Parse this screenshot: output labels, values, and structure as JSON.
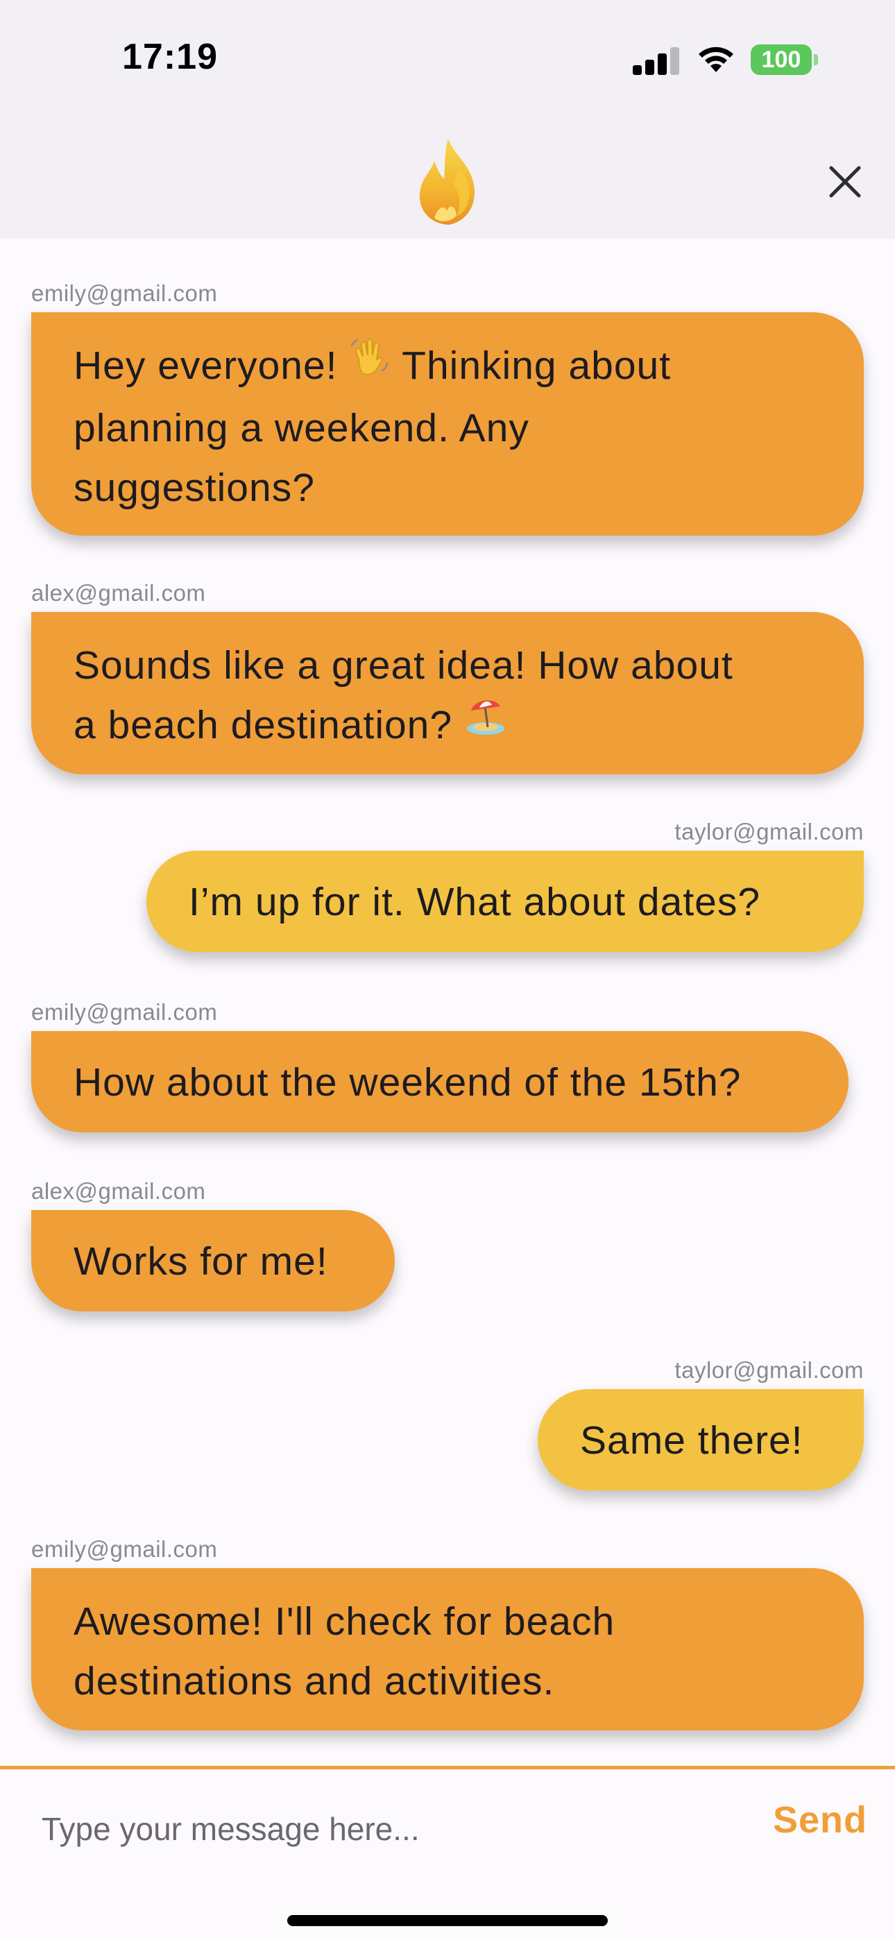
{
  "status_bar": {
    "time": "17:19",
    "battery_level": "100",
    "icons": [
      "cellular-signal-icon",
      "wifi-icon",
      "battery-icon"
    ]
  },
  "header": {
    "logo_icon": "flame-logo-icon",
    "close_icon": "close-icon"
  },
  "messages": [
    {
      "sender": "emily@gmail.com",
      "side": "left",
      "lines": [
        "Hey everyone! ",
        " Thinking about",
        "planning a weekend. Any",
        "suggestions?"
      ],
      "emoji": "waving-hand-emoji"
    },
    {
      "sender": "alex@gmail.com",
      "side": "left",
      "lines": [
        "Sounds like a great idea! How about",
        "a beach destination? "
      ],
      "emoji": "beach-umbrella-emoji"
    },
    {
      "sender": "taylor@gmail.com",
      "side": "right",
      "lines": [
        "I’m up for it. What about dates?"
      ]
    },
    {
      "sender": "emily@gmail.com",
      "side": "left",
      "lines": [
        "How about the weekend of the 15th?"
      ]
    },
    {
      "sender": "alex@gmail.com",
      "side": "left",
      "lines": [
        "Works for me!"
      ]
    },
    {
      "sender": "taylor@gmail.com",
      "side": "right",
      "lines": [
        "Same there!"
      ]
    },
    {
      "sender": "emily@gmail.com",
      "side": "left",
      "lines": [
        "Awesome! I'll check for beach",
        "destinations and activities."
      ]
    }
  ],
  "composer": {
    "placeholder": "Type your message here...",
    "value": "",
    "send_label": "Send"
  },
  "colors": {
    "other_bubble": "#f09e38",
    "my_bubble": "#f3c242",
    "accent": "#f09e38",
    "header_background": "#f2eff5",
    "page_background": "#fcfafd",
    "sender_text": "#8a8a8e"
  }
}
